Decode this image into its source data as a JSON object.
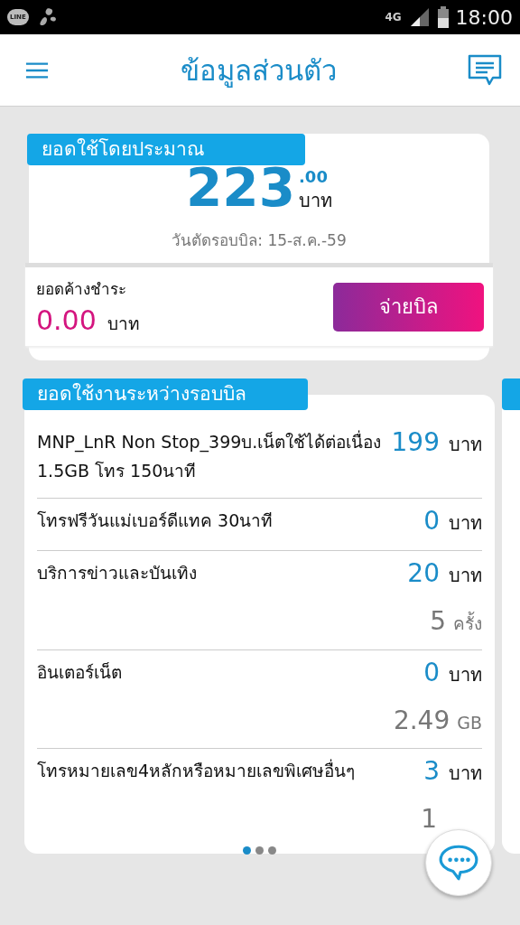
{
  "status_bar": {
    "app_badge": "LINE",
    "network": "4G",
    "time": "18:00"
  },
  "header": {
    "title": "ข้อมูลส่วนตัว"
  },
  "estimate_card": {
    "tab": "ยอดใช้โดยประมาณ",
    "amount": "223",
    "decimals": ".00",
    "unit": "บาท",
    "cycle_date": "วันตัดรอบบิล: 15-ส.ค.-59",
    "outstanding_label": "ยอดค้างชำระ",
    "outstanding_amount": "0.00",
    "outstanding_unit": "บาท",
    "pay_button": "จ่ายบิล"
  },
  "usage_card": {
    "tab": "ยอดใช้งานระหว่างรอบบิล",
    "rows": [
      {
        "label": "MNP_LnR Non Stop_399บ.เน็ตใช้ได้ต่อเนื่อง 1.5GB โทร 150นาที",
        "amount": "199",
        "unit": "บาท"
      },
      {
        "label": "โทรฟรีวันแม่เบอร์ดีแทค 30นาที",
        "amount": "0",
        "unit": "บาท"
      },
      {
        "label": "บริการข่าวและบันเทิง",
        "amount": "20",
        "unit": "บาท",
        "sub_amount": "5",
        "sub_unit": "ครั้ง"
      },
      {
        "label": "อินเตอร์เน็ต",
        "amount": "0",
        "unit": "บาท",
        "sub_amount": "2.49",
        "sub_unit": "GB"
      },
      {
        "label": "โทรหมายเลข4หลักหรือหมายเลขพิเศษอื่นๆ",
        "amount": "3",
        "unit": "บาท",
        "sub_amount": "1"
      }
    ]
  },
  "pager": [
    {
      "selected": true
    },
    {
      "selected": false
    },
    {
      "selected": false
    }
  ]
}
